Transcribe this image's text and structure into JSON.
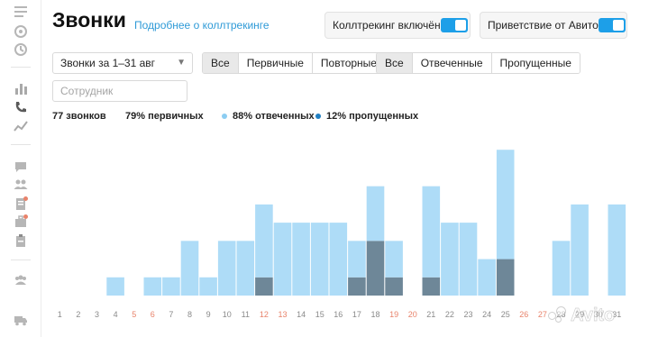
{
  "header": {
    "title": "Звонки",
    "link": "Подробнее о коллтрекинге"
  },
  "toggles": [
    {
      "label": "Коллтрекинг включён",
      "on": true
    },
    {
      "label": "Приветствие от Авито",
      "on": true
    }
  ],
  "filters": {
    "period": "Звонки за 1–31 авг",
    "staff_placeholder": "Сотрудник",
    "type_segments": [
      {
        "label": "Все",
        "active": true
      },
      {
        "label": "Первичные",
        "active": false
      },
      {
        "label": "Повторные",
        "active": false
      }
    ],
    "status_segments": [
      {
        "label": "Все",
        "active": true
      },
      {
        "label": "Отвеченные",
        "active": false
      },
      {
        "label": "Пропущенные",
        "active": false
      }
    ]
  },
  "stats": {
    "total": "77 звонков",
    "primary": "79% первичных",
    "answered": "88% отвеченных",
    "missed": "12% пропущенных"
  },
  "colors": {
    "answered": "#aedcf7",
    "missed": "#6e8798",
    "answered_dot": "#8ccdf2",
    "missed_dot": "#1f7fc2",
    "weekend": "#e8836b",
    "accent": "#1d9fe8"
  },
  "watermark": "Avito",
  "chart_data": {
    "type": "bar",
    "stacked": true,
    "categories": [
      "1",
      "2",
      "3",
      "4",
      "5",
      "6",
      "7",
      "8",
      "9",
      "10",
      "11",
      "12",
      "13",
      "14",
      "15",
      "16",
      "17",
      "18",
      "19",
      "20",
      "21",
      "22",
      "23",
      "24",
      "25",
      "26",
      "27",
      "28",
      "29",
      "30",
      "31"
    ],
    "weekend_days": [
      "5",
      "6",
      "12",
      "13",
      "19",
      "20",
      "26",
      "27"
    ],
    "series": [
      {
        "values": [
          0,
          0,
          0,
          1,
          0,
          1,
          1,
          2,
          1,
          2,
          2,
          2,
          1,
          1,
          3,
          3,
          1,
          2,
          1,
          0,
          2,
          4,
          3,
          1,
          3,
          0,
          0,
          2,
          4,
          0,
          4
        ]
      },
      {
        "values": [
          0,
          0,
          0,
          0,
          0,
          0,
          0,
          1,
          0,
          1,
          1,
          2,
          3,
          3,
          1,
          1,
          1,
          1,
          1,
          0,
          3,
          0,
          1,
          1,
          3,
          0,
          0,
          1,
          1,
          0,
          1
        ]
      },
      {
        "values": [
          0,
          0,
          0,
          0,
          0,
          0,
          0,
          0,
          0,
          0,
          0,
          1,
          0,
          0,
          0,
          0,
          1,
          3,
          1,
          0,
          1,
          0,
          0,
          0,
          2,
          0,
          0,
          0,
          0,
          0,
          0
        ]
      }
    ],
    "ylim": [
      0,
      9
    ]
  }
}
